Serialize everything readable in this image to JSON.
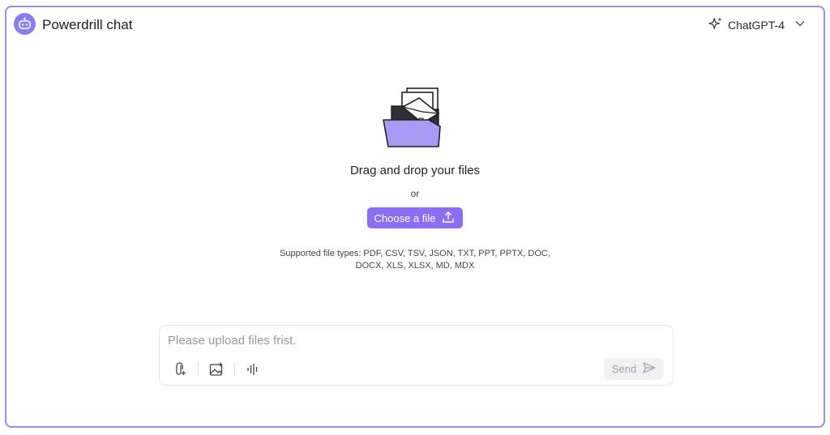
{
  "header": {
    "app_title": "Powerdrill chat",
    "logo_icon": "robot-icon",
    "model_label": "ChatGPT-4",
    "model_icon": "sparkle-icon",
    "dropdown_icon": "chevron-down-icon"
  },
  "dropzone": {
    "illustration": "folder-files-icon",
    "title": "Drag and drop your files",
    "or_text": "or",
    "choose_label": "Choose a file",
    "choose_icon": "upload-icon",
    "supported_line1": "Supported file types: PDF, CSV, TSV, JSON, TXT, PPT, PPTX, DOC,",
    "supported_line2": "DOCX, XLS, XLSX, MD, MDX"
  },
  "chat": {
    "placeholder": "Please upload files frist.",
    "value": "",
    "tools": [
      "attach-file-icon",
      "add-image-icon",
      "voice-wave-icon"
    ],
    "send_label": "Send",
    "send_icon": "send-icon"
  },
  "colors": {
    "accent": "#8b6ff3",
    "frame_border": "#9a8cf0",
    "logo_bg": "#8b7cf2"
  }
}
